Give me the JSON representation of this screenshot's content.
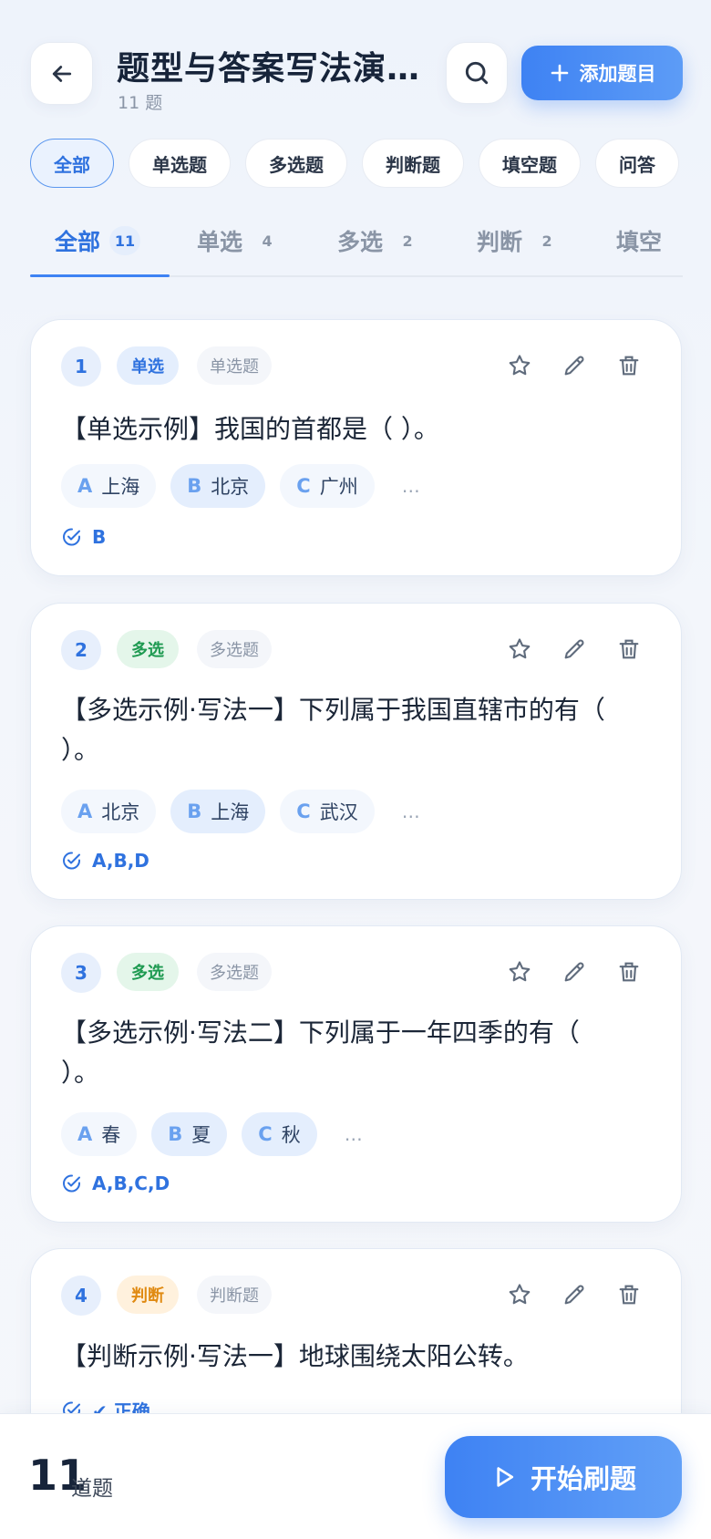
{
  "header": {
    "title": "题型与答案写法演…",
    "subtitle": "11 题",
    "add_label": "添加题目"
  },
  "filter_chips": [
    "全部",
    "单选题",
    "多选题",
    "判断题",
    "填空题",
    "问答"
  ],
  "tabs": [
    {
      "label": "全部",
      "count": "11"
    },
    {
      "label": "单选",
      "count": "4"
    },
    {
      "label": "多选",
      "count": "2"
    },
    {
      "label": "判断",
      "count": "2"
    },
    {
      "label": "填空",
      "count": ""
    }
  ],
  "questions": [
    {
      "num": "1",
      "type": "单选",
      "category": "单选题",
      "text_lines": [
        "【单选示例】我国的首都是（ ）。"
      ],
      "options": [
        {
          "letter": "A",
          "text": "上海"
        },
        {
          "letter": "B",
          "text": "北京"
        },
        {
          "letter": "C",
          "text": "广州"
        }
      ],
      "more": "…",
      "answer": "B"
    },
    {
      "num": "2",
      "type": "多选",
      "category": "多选题",
      "text_lines": [
        "【多选示例·写法一】下列属于我国直辖市的有（",
        "）。"
      ],
      "options": [
        {
          "letter": "A",
          "text": "北京"
        },
        {
          "letter": "B",
          "text": "上海"
        },
        {
          "letter": "C",
          "text": "武汉"
        }
      ],
      "more": "…",
      "answer": "A,B,D"
    },
    {
      "num": "3",
      "type": "多选",
      "category": "多选题",
      "text_lines": [
        "【多选示例·写法二】下列属于一年四季的有（",
        "）。"
      ],
      "options": [
        {
          "letter": "A",
          "text": "春"
        },
        {
          "letter": "B",
          "text": "夏"
        },
        {
          "letter": "C",
          "text": "秋"
        }
      ],
      "more": "…",
      "answer": "A,B,C,D"
    },
    {
      "num": "4",
      "type": "判断",
      "category": "判断题",
      "text_lines": [
        "【判断示例·写法一】地球围绕太阳公转。"
      ],
      "answer": "✔ 正确"
    }
  ],
  "footer": {
    "total": "11",
    "total_label": "道题",
    "start_label": "开始刷题"
  },
  "colors": {
    "accent": "#3e82f3",
    "multi": "#1e9a51",
    "judge": "#e08a12"
  }
}
